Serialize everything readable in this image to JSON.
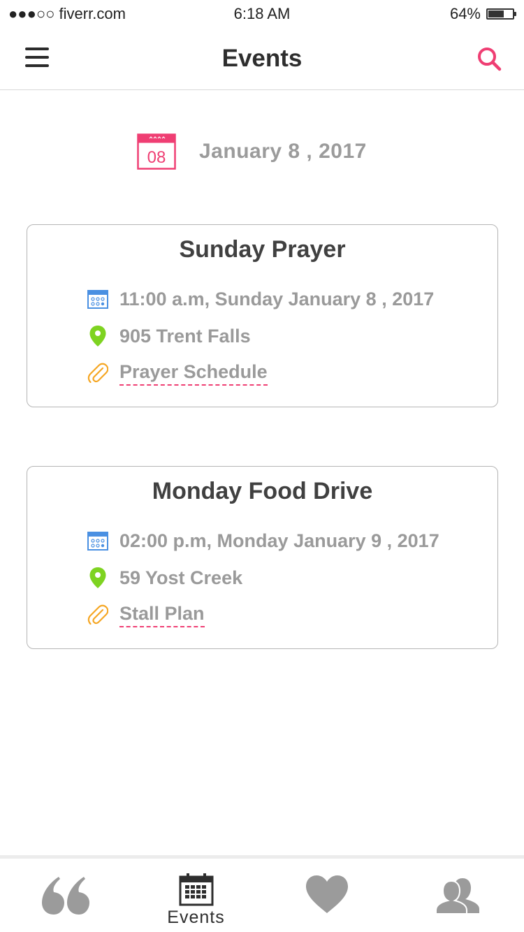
{
  "status_bar": {
    "carrier": "●●●○○ fiverr.com",
    "time": "6:18 AM",
    "battery_percent": "64%",
    "battery_level": 0.64
  },
  "header": {
    "title": "Events",
    "menu_icon": "hamburger-menu-icon",
    "search_icon": "search-icon"
  },
  "date_header": {
    "day": "08",
    "date": "January 8 , 2017",
    "icon": "calendar-icon"
  },
  "events": [
    {
      "title": "Sunday Prayer",
      "datetime": "11:00 a.m, Sunday January 8 , 2017",
      "location": "905 Trent Falls",
      "attachment": "Prayer Schedule"
    },
    {
      "title": "Monday Food Drive",
      "datetime": "02:00 p.m, Monday January 9 , 2017",
      "location": "59 Yost Creek",
      "attachment": "Stall Plan"
    }
  ],
  "tabs": [
    {
      "icon": "quote-icon",
      "label": ""
    },
    {
      "icon": "calendar-icon",
      "label": "Events"
    },
    {
      "icon": "heart-icon",
      "label": ""
    },
    {
      "icon": "people-icon",
      "label": ""
    }
  ],
  "colors": {
    "accent": "#ef3e73",
    "location_green": "#7ed321",
    "calendar_blue": "#4a90e2",
    "attachment_orange": "#f5a623",
    "muted_text": "#9b9b9b",
    "tab_gray": "#9b9b9b"
  }
}
